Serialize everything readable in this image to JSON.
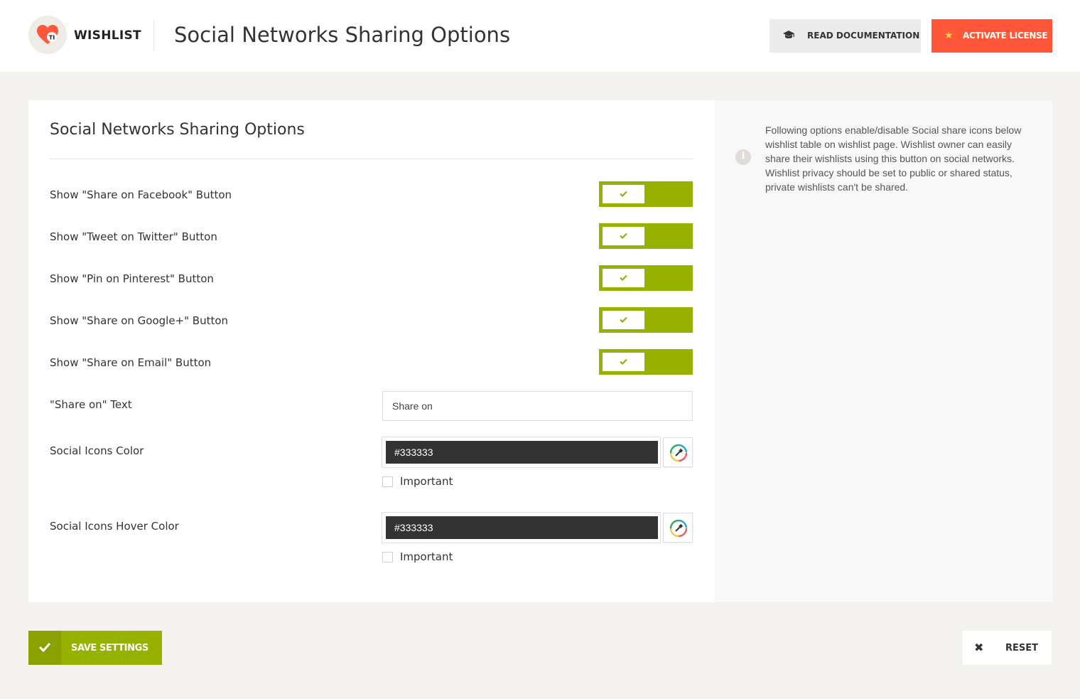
{
  "header": {
    "brand": "WISHLIST",
    "title": "Social Networks Sharing Options",
    "docs_button": "READ DOCUMENTATION",
    "license_button": "ACTIVATE LICENSE"
  },
  "section": {
    "title": "Social Networks Sharing Options"
  },
  "options": [
    {
      "label": "Show \"Share on Facebook\" Button",
      "enabled": true
    },
    {
      "label": "Show \"Tweet on Twitter\" Button",
      "enabled": true
    },
    {
      "label": "Show \"Pin on Pinterest\" Button",
      "enabled": true
    },
    {
      "label": "Show \"Share on Google+\" Button",
      "enabled": true
    },
    {
      "label": "Show \"Share on Email\" Button",
      "enabled": true
    }
  ],
  "share_text": {
    "label": "\"Share on\" Text",
    "value": "Share on"
  },
  "icons_color": {
    "label": "Social Icons Color",
    "value": "#333333",
    "important_label": "Important"
  },
  "icons_hover_color": {
    "label": "Social Icons Hover Color",
    "value": "#333333",
    "important_label": "Important"
  },
  "info": {
    "text": "Following options enable/disable Social share icons below wishlist table on wishlist page. Wishlist owner can easily share their wishlists using this button on social networks. Wishlist privacy should be set to public or shared status, private wishlists can't be shared."
  },
  "footer": {
    "save_label": "SAVE SETTINGS",
    "reset_label": "RESET"
  },
  "colors": {
    "accent_green": "#96b100",
    "accent_orange": "#ff5739",
    "background": "#f4f2ee"
  }
}
